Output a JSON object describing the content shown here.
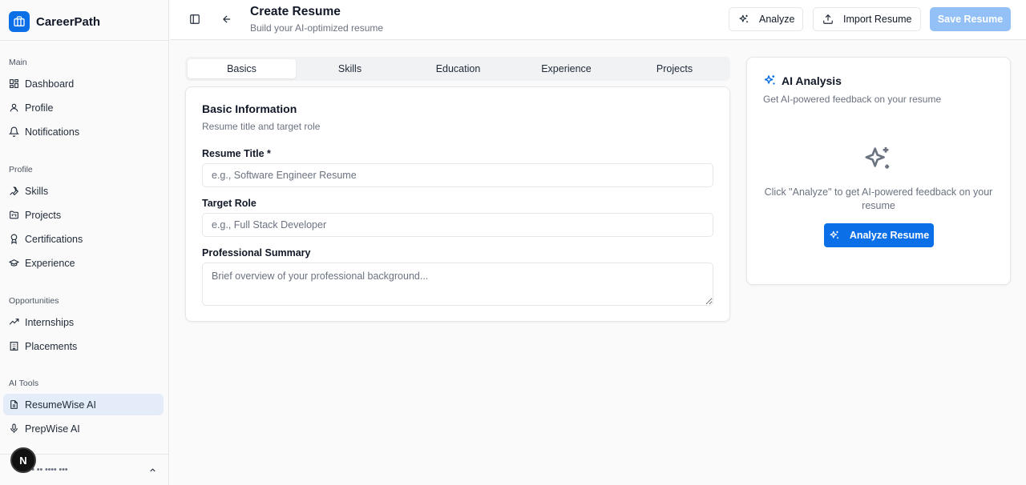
{
  "app": {
    "name": "CareerPath",
    "accent": "#0b6fe8"
  },
  "sidebar": {
    "groups": [
      {
        "label": "Main",
        "items": [
          {
            "label": "Dashboard",
            "icon": "dashboard-icon"
          },
          {
            "label": "Profile",
            "icon": "user-icon"
          },
          {
            "label": "Notifications",
            "icon": "bell-icon"
          }
        ]
      },
      {
        "label": "Profile",
        "items": [
          {
            "label": "Skills",
            "icon": "wrench-icon"
          },
          {
            "label": "Projects",
            "icon": "folder-kanban-icon"
          },
          {
            "label": "Certifications",
            "icon": "award-icon"
          },
          {
            "label": "Experience",
            "icon": "graduation-cap-icon"
          }
        ]
      },
      {
        "label": "Opportunities",
        "items": [
          {
            "label": "Internships",
            "icon": "trending-up-icon"
          },
          {
            "label": "Placements",
            "icon": "building-icon"
          }
        ]
      },
      {
        "label": "AI Tools",
        "items": [
          {
            "label": "ResumeWise AI",
            "icon": "file-text-icon",
            "active": true
          },
          {
            "label": "PrepWise AI",
            "icon": "mic-icon"
          }
        ]
      }
    ],
    "user": {
      "name": "••• •• •••• •••",
      "badge": "N"
    }
  },
  "header": {
    "title": "Create Resume",
    "subtitle": "Build your AI-optimized resume",
    "analyze_label": "Analyze",
    "import_label": "Import Resume",
    "save_label": "Save Resume"
  },
  "tabs": [
    {
      "label": "Basics",
      "active": true
    },
    {
      "label": "Skills"
    },
    {
      "label": "Education"
    },
    {
      "label": "Experience"
    },
    {
      "label": "Projects"
    }
  ],
  "basic_info": {
    "title": "Basic Information",
    "subtitle": "Resume title and target role",
    "fields": {
      "resume_title": {
        "label": "Resume Title *",
        "value": "",
        "placeholder": "e.g., Software Engineer Resume"
      },
      "target_role": {
        "label": "Target Role",
        "value": "",
        "placeholder": "e.g., Full Stack Developer"
      },
      "summary": {
        "label": "Professional Summary",
        "value": "",
        "placeholder": "Brief overview of your professional background..."
      }
    }
  },
  "ai_panel": {
    "title": "AI Analysis",
    "subtitle": "Get AI-powered feedback on your resume",
    "empty_text": "Click \"Analyze\" to get AI-powered feedback on your resume",
    "button_label": "Analyze Resume"
  }
}
